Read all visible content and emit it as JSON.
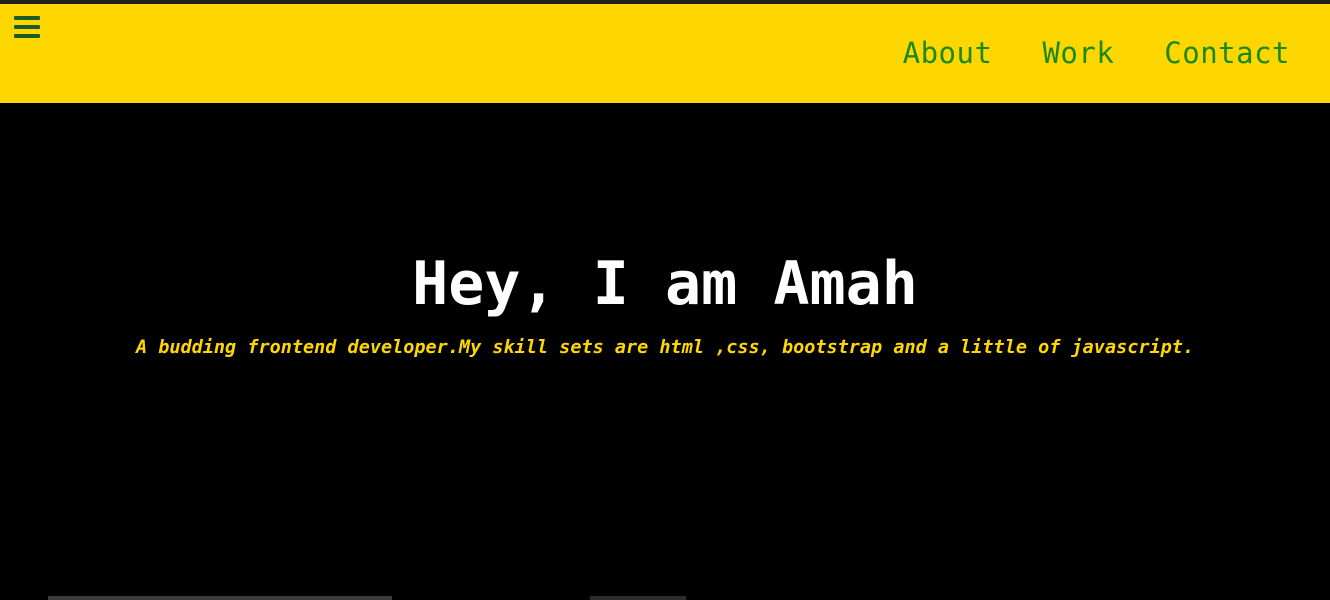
{
  "colors": {
    "navbar_bg": "#FFD700",
    "nav_link": "#1b8a14",
    "menu_icon": "#1a5c26",
    "hero_bg": "#000000",
    "hero_title": "#ffffff",
    "hero_subtitle": "#FFD700"
  },
  "navbar": {
    "menu_icon": "hamburger-menu-icon",
    "links": [
      {
        "label": "About"
      },
      {
        "label": "Work"
      },
      {
        "label": "Contact"
      }
    ]
  },
  "hero": {
    "title": "Hey, I am Amah",
    "subtitle": "A budding frontend developer.My skill sets are html ,css, bootstrap and a little of javascript."
  }
}
